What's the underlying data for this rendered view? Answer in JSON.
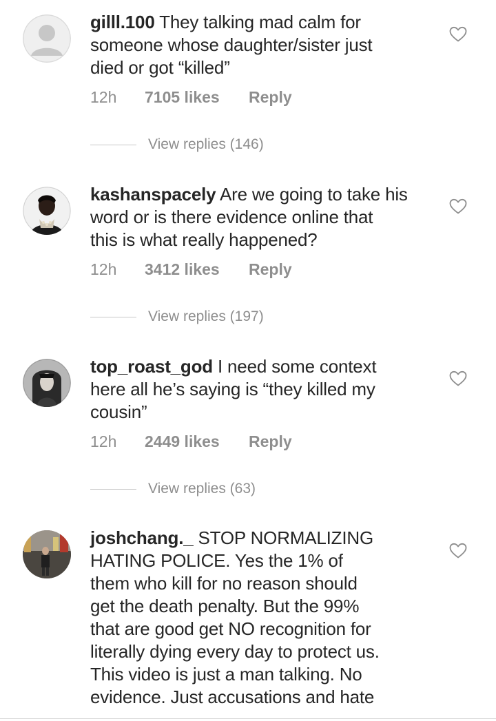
{
  "comments": [
    {
      "username": "gilll.100",
      "text": "They talking mad calm for",
      "lines": [
        "someone whose daughter/sister just",
        "died or got “killed”"
      ],
      "time": "12h",
      "likes": "7105 likes",
      "reply": "Reply",
      "view_replies": "View replies (146)",
      "avatar": "default-avatar"
    },
    {
      "username": "kashanspacely",
      "text": "Are we going to take his",
      "lines": [
        "word or is there evidence online that",
        "this is what really happened?"
      ],
      "time": "12h",
      "likes": "3412 likes",
      "reply": "Reply",
      "view_replies": "View replies (197)",
      "avatar": "photo-avatar"
    },
    {
      "username": "top_roast_god",
      "text": "I need some context",
      "lines": [
        "here all he’s saying is “they killed my",
        "cousin”"
      ],
      "time": "12h",
      "likes": "2449 likes",
      "reply": "Reply",
      "view_replies": "View replies (63)",
      "avatar": "photo-avatar"
    },
    {
      "username": "joshchang._",
      "text": "STOP NORMALIZING",
      "lines": [
        "HATING POLICE. Yes the 1% of",
        "them who kill for no reason should",
        "get the death penalty. But the 99%",
        "that are good get NO recognition for",
        "literally dying every day to protect us.",
        "This video is just a man talking. No",
        "evidence. Just accusations and hate"
      ],
      "avatar": "photo-avatar"
    }
  ],
  "icons": {
    "like": "heart-outline-icon"
  },
  "colors": {
    "text": "#262626",
    "secondary": "#8e8e8e",
    "divider": "#c7c7c7"
  }
}
